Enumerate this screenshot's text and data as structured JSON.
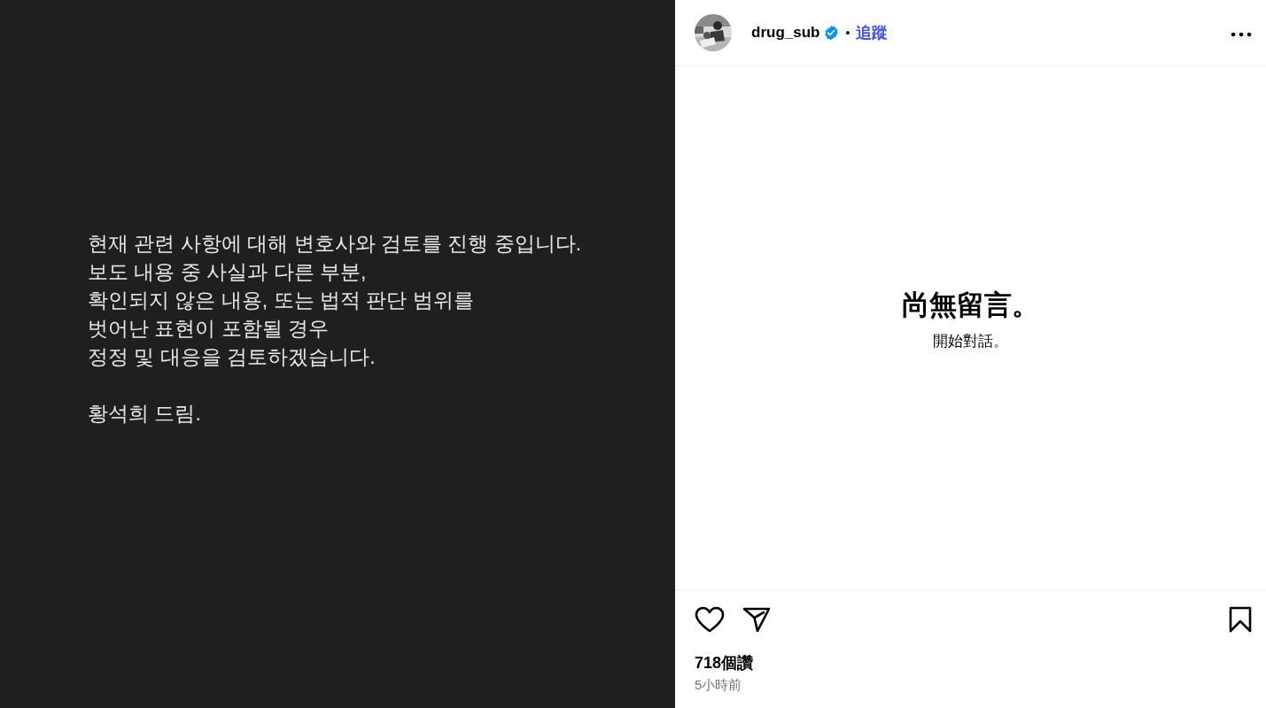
{
  "post_image": {
    "lines": [
      "현재 관련 사항에 대해 변호사와 검토를 진행 중입니다.",
      "보도 내용 중 사실과 다른 부분,",
      "확인되지 않은 내용, 또는 법적 판단 범위를",
      "벗어난 표현이 포함될 경우",
      "정정 및 대응을 검토하겠습니다."
    ],
    "signature": "황석희 드림."
  },
  "header": {
    "username": "drug_sub",
    "verified": true,
    "separator": "•",
    "follow": "追蹤"
  },
  "comments": {
    "empty_title": "尚無留言。",
    "empty_subtitle": "開始對話。"
  },
  "actions": {
    "liked": false,
    "saved": false
  },
  "likes": "718個讚",
  "time": "5小時前"
}
